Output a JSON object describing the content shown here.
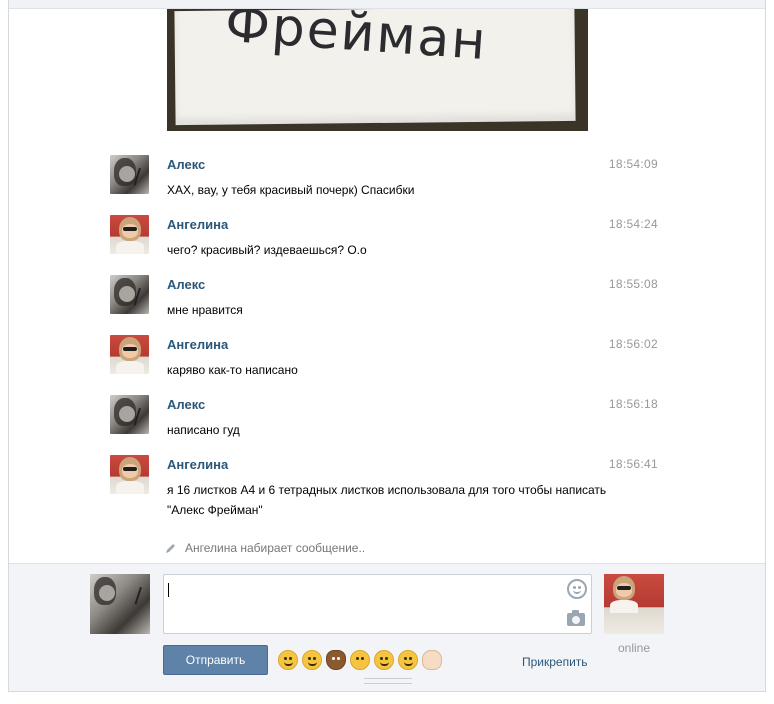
{
  "photo": {
    "handwriting": "Фрейман"
  },
  "messages": [
    {
      "author": "Алекс",
      "time": "18:54:09",
      "text": "ХАХ, вау, у тебя красивый почерк) Спасибки",
      "avatar": "alex"
    },
    {
      "author": "Ангелина",
      "time": "18:54:24",
      "text": "чего? красивый? издеваешься? О.о",
      "avatar": "angelina"
    },
    {
      "author": "Алекс",
      "time": "18:55:08",
      "text": "мне нравится",
      "avatar": "alex"
    },
    {
      "author": "Ангелина",
      "time": "18:56:02",
      "text": "каряво как-то написано",
      "avatar": "angelina"
    },
    {
      "author": "Алекс",
      "time": "18:56:18",
      "text": "написано гуд",
      "avatar": "alex"
    },
    {
      "author": "Ангелина",
      "time": "18:56:41",
      "text": "я 16 листков А4 и 6 тетрадных листков использовала для того чтобы написать \"Алекс Фрейман\"",
      "avatar": "angelina"
    }
  ],
  "typing_indicator": "Ангелина набирает сообщение..",
  "composer": {
    "input_value": "",
    "send_label": "Отправить",
    "attach_label": "Прикрепить",
    "peer_status": "online",
    "emojis": [
      "laughing-face-icon",
      "winking-face-icon",
      "deer-icon",
      "kissing-face-icon",
      "smiling-face-icon",
      "relieved-face-icon",
      "ok-hand-icon"
    ]
  },
  "colors": {
    "name": "#2b587a",
    "send_button": "#5e82a8",
    "time": "#999999"
  }
}
